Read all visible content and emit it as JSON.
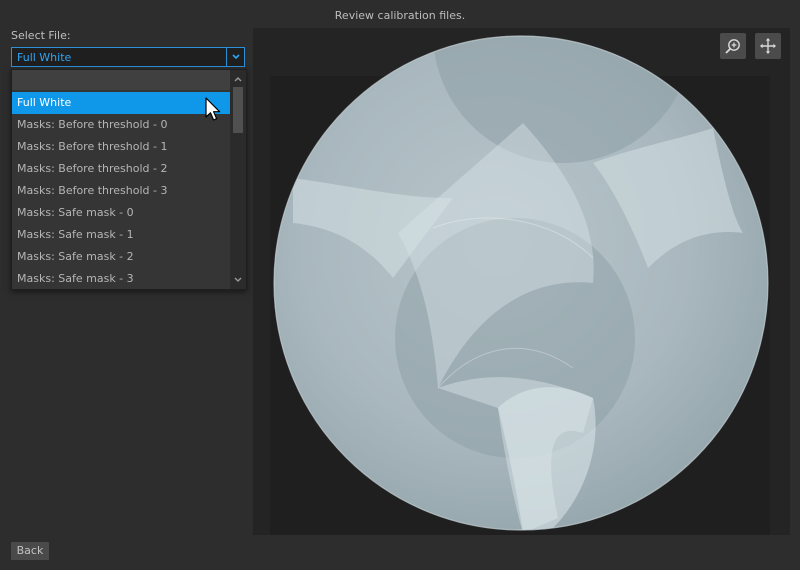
{
  "header": {
    "title": "Review calibration files."
  },
  "file_select": {
    "label": "Select File:",
    "selected_value": "Full White",
    "options": [
      "Full White",
      "Masks: Before threshold - 0",
      "Masks: Before threshold - 1",
      "Masks: Before threshold - 2",
      "Masks: Before threshold - 3",
      "Masks: Safe mask - 0",
      "Masks: Safe mask - 1",
      "Masks: Safe mask - 2",
      "Masks: Safe mask - 3"
    ]
  },
  "viewer": {
    "tools": [
      "zoom-in-icon",
      "move-icon"
    ]
  },
  "footer": {
    "back_label": "Back"
  },
  "colors": {
    "accent": "#0f97ea",
    "accent_border": "#2d8fd6",
    "background": "#2d2d2d",
    "viewer_bg": "#242424"
  }
}
